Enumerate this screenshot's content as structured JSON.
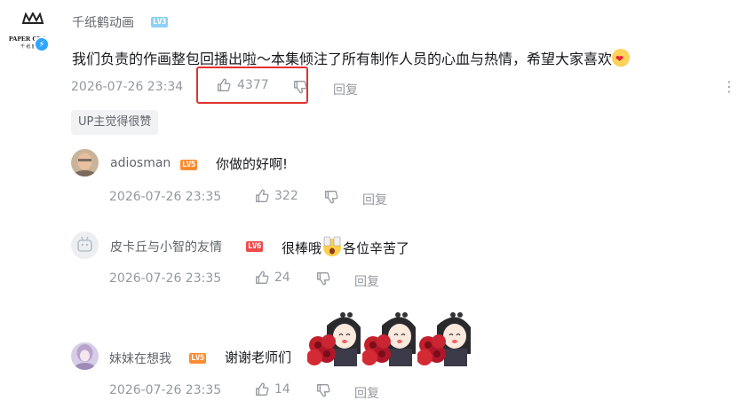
{
  "main_comment": {
    "username": "千纸鹤动画",
    "level": "LV3",
    "content": "我们负责的作画整包回播出啦～本集倾注了所有制作人员的心血与热情，希望大家喜欢",
    "time": "2026-07-26 23:34",
    "likes": "4377",
    "reply_label": "回复",
    "up_tag": "UP主觉得很赞"
  },
  "replies": [
    {
      "username": "adiosman",
      "level": "LV5",
      "content": "你做的好啊!",
      "time": "2026-07-26 23:35",
      "likes": "322",
      "reply_label": "回复"
    },
    {
      "username": "皮卡丘与小智的友情",
      "level": "LV6",
      "content_before": "很棒哦",
      "content_after": "各位辛苦了",
      "time": "2026-07-26 23:35",
      "likes": "24",
      "reply_label": "回复"
    },
    {
      "username": "妹妹在想我",
      "level": "LV5",
      "content": "谢谢老师们",
      "time": "2026-07-26 23:35",
      "likes": "14",
      "reply_label": "回复"
    }
  ],
  "colors": {
    "highlight_box": "#e33131",
    "username": "#61666d",
    "meta": "#9499a0",
    "lv3": "#8ed1f7",
    "lv5": "#ff8c32",
    "lv6": "#ee4a4a"
  }
}
